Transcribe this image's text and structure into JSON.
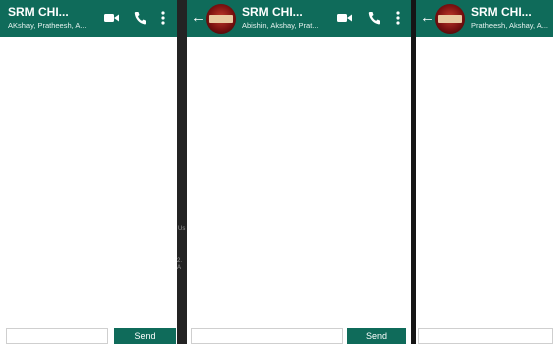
{
  "panels": [
    {
      "chat_title": "SRM CHI...",
      "chat_subtitle": "AKshay, Pratheesh, A...",
      "send_label": "Send",
      "message_placeholder": ""
    },
    {
      "chat_title": "SRM CHI...",
      "chat_subtitle": "Abishin, Akshay, Prat...",
      "send_label": "Send",
      "message_placeholder": ""
    },
    {
      "chat_title": "SRM CHI...",
      "chat_subtitle": "Pratheesh, Akshay, A...",
      "message_placeholder": ""
    }
  ],
  "artifacts": [
    "Us",
    "2. A"
  ],
  "icons": [
    "back-arrow-icon",
    "video-call-icon",
    "phone-icon",
    "more-vert-icon"
  ],
  "colors": {
    "header": "#0f6b5a",
    "send_button": "#0f6b5a",
    "divider": "#232323"
  }
}
